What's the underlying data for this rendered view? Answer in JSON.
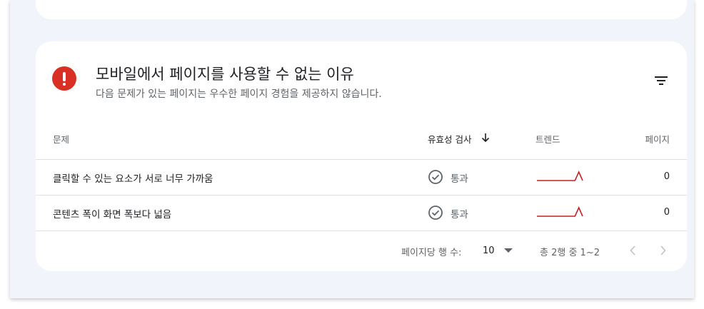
{
  "section": {
    "title": "모바일에서 페이지를 사용할 수 없는 이유",
    "subtitle": "다음 문제가 있는 페이지는 우수한 페이지 경험을 제공하지 않습니다.",
    "icon": "error-icon",
    "filter_icon": "filter-icon"
  },
  "table": {
    "headers": {
      "issue": "문제",
      "validation": "유효성 검사",
      "trend": "트렌드",
      "pages": "페이지"
    },
    "sort_icon": "arrow-down-icon",
    "rows": [
      {
        "issue": "클릭할 수 있는 요소가 서로 너무 가까움",
        "status": "통과",
        "status_icon": "check-circle-icon",
        "trend": [
          0,
          0,
          0,
          0,
          0,
          0,
          0,
          0,
          0,
          0,
          0,
          1,
          0
        ],
        "pages": "0"
      },
      {
        "issue": "콘텐츠 폭이 화면 폭보다 넓음",
        "status": "통과",
        "status_icon": "check-circle-icon",
        "trend": [
          0,
          0,
          0,
          0,
          0,
          0,
          0,
          0,
          0,
          0,
          0,
          1,
          0
        ],
        "pages": "0"
      }
    ]
  },
  "pagination": {
    "rows_per_page_label": "페이지당 행 수:",
    "rows_per_page": "10",
    "range": "총 2행 중 1~2",
    "prev_icon": "chevron-left-icon",
    "next_icon": "chevron-right-icon"
  },
  "colors": {
    "error": "#d93025",
    "trend_line": "#c5221f",
    "muted": "#5f6368",
    "background": "#f1f4fb"
  }
}
